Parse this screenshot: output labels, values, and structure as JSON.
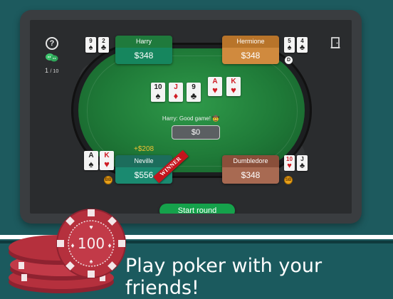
{
  "hud": {
    "round_num": "1",
    "round_total": "/ 10"
  },
  "players": {
    "harry": {
      "name": "Harry",
      "stack": "$348"
    },
    "hermione": {
      "name": "Hermione",
      "stack": "$348"
    },
    "neville": {
      "name": "Neville",
      "stack": "$556"
    },
    "dumbledore": {
      "name": "Dumbledore",
      "stack": "$348"
    }
  },
  "cards": {
    "harry": [
      {
        "rank": "9",
        "suit": "♠"
      },
      {
        "rank": "2",
        "suit": "♣"
      }
    ],
    "hermione": [
      {
        "rank": "5",
        "suit": "♠"
      },
      {
        "rank": "4",
        "suit": "♣"
      }
    ],
    "neville": [
      {
        "rank": "A",
        "suit": "♠"
      },
      {
        "rank": "K",
        "suit": "♥"
      }
    ],
    "dumbledore": [
      {
        "rank": "10",
        "suit": "♥"
      },
      {
        "rank": "J",
        "suit": "♣"
      }
    ],
    "board": [
      {
        "rank": "10",
        "suit": "♠"
      },
      {
        "rank": "J",
        "suit": "♦"
      },
      {
        "rank": "9",
        "suit": "♣"
      },
      {
        "rank": "A",
        "suit": "♥"
      },
      {
        "rank": "K",
        "suit": "♥"
      }
    ]
  },
  "buttons": {
    "dealer": "D",
    "big_blind": "BB",
    "small_blind": "SB"
  },
  "chat_message": "Harry: Good game! 🤠",
  "pot": "$0",
  "win_amount": "+$208",
  "winner_label": "WINNER",
  "start_round_label": "Start round",
  "chip_value": "100",
  "tagline": "Play poker with your friends!",
  "colors": {
    "background": "#1d5a5e",
    "felt": "#1f7a38",
    "start_button": "#15a24b",
    "winner_ribbon": "#c4141c",
    "chip": "#b5303d"
  }
}
